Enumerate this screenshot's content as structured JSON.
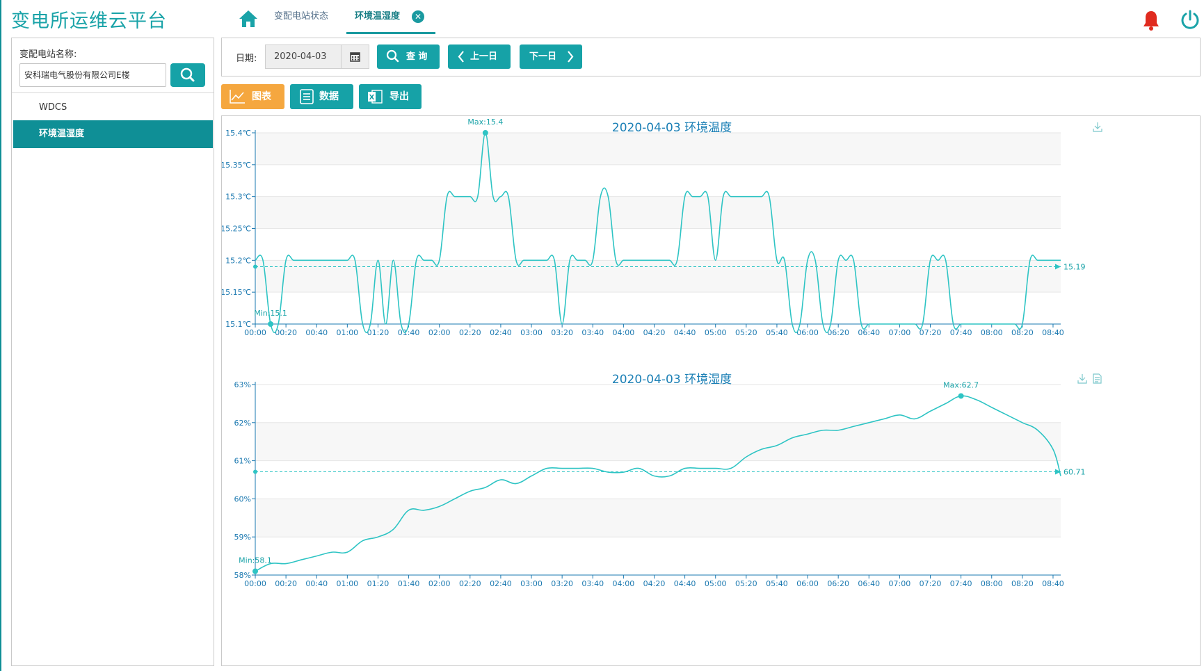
{
  "header": {
    "app_title": "变电所运维云平台",
    "tabs": [
      {
        "label": "变配电站状态"
      },
      {
        "label": "环境温湿度"
      }
    ]
  },
  "sidebar": {
    "search_label": "变配电站名称:",
    "search_value": "安科瑞电气股份有限公司E楼",
    "items": [
      {
        "label": "WDCS"
      },
      {
        "label": "环境温湿度"
      }
    ]
  },
  "toolbar": {
    "date_label": "日期:",
    "date_value": "2020-04-03",
    "query_label": "查 询",
    "prev_label": "上一日",
    "next_label": "下一日"
  },
  "view_buttons": {
    "chart_label": "图表",
    "data_label": "数据",
    "export_label": "导出"
  },
  "colors": {
    "accent": "#16a2a7",
    "line": "#2ec4c4",
    "active_tab": "#f5a73f",
    "bell": "#e02b1f"
  },
  "chart_data": [
    {
      "type": "line",
      "title": "2020-04-03  环境温度",
      "x": [
        "00:00",
        "00:05",
        "00:10",
        "00:15",
        "00:20",
        "00:25",
        "00:30",
        "00:35",
        "00:40",
        "00:45",
        "00:50",
        "00:55",
        "01:00",
        "01:05",
        "01:10",
        "01:15",
        "01:20",
        "01:25",
        "01:30",
        "01:35",
        "01:40",
        "01:45",
        "01:50",
        "01:55",
        "02:00",
        "02:05",
        "02:10",
        "02:15",
        "02:20",
        "02:25",
        "02:30",
        "02:35",
        "02:40",
        "02:45",
        "02:50",
        "02:55",
        "03:00",
        "03:05",
        "03:10",
        "03:15",
        "03:20",
        "03:25",
        "03:30",
        "03:35",
        "03:40",
        "03:45",
        "03:50",
        "03:55",
        "04:00",
        "04:05",
        "04:10",
        "04:15",
        "04:20",
        "04:25",
        "04:30",
        "04:35",
        "04:40",
        "04:45",
        "04:50",
        "04:55",
        "05:00",
        "05:05",
        "05:10",
        "05:15",
        "05:20",
        "05:25",
        "05:30",
        "05:35",
        "05:40",
        "05:45",
        "05:50",
        "05:55",
        "06:00",
        "06:05",
        "06:10",
        "06:15",
        "06:20",
        "06:25",
        "06:30",
        "06:35",
        "06:40",
        "06:45",
        "06:50",
        "06:55",
        "07:00",
        "07:05",
        "07:10",
        "07:15",
        "07:20",
        "07:25",
        "07:30",
        "07:35",
        "07:40",
        "07:45",
        "07:50",
        "07:55",
        "08:00",
        "08:05",
        "08:10",
        "08:15",
        "08:20",
        "08:25",
        "08:30",
        "08:35",
        "08:40",
        "08:45"
      ],
      "series": [
        {
          "values": [
            15.2,
            15.2,
            15.1,
            15.1,
            15.2,
            15.2,
            15.2,
            15.2,
            15.2,
            15.2,
            15.2,
            15.2,
            15.2,
            15.2,
            15.1,
            15.1,
            15.2,
            15.1,
            15.2,
            15.1,
            15.1,
            15.2,
            15.2,
            15.2,
            15.2,
            15.3,
            15.3,
            15.3,
            15.3,
            15.3,
            15.4,
            15.3,
            15.3,
            15.3,
            15.2,
            15.2,
            15.2,
            15.2,
            15.2,
            15.2,
            15.1,
            15.2,
            15.2,
            15.2,
            15.2,
            15.3,
            15.3,
            15.2,
            15.2,
            15.2,
            15.2,
            15.2,
            15.2,
            15.2,
            15.2,
            15.2,
            15.3,
            15.3,
            15.3,
            15.3,
            15.2,
            15.3,
            15.3,
            15.3,
            15.3,
            15.3,
            15.3,
            15.3,
            15.2,
            15.2,
            15.1,
            15.1,
            15.2,
            15.2,
            15.1,
            15.1,
            15.2,
            15.2,
            15.2,
            15.1,
            15.1,
            15.1,
            15.1,
            15.1,
            15.1,
            15.1,
            15.1,
            15.1,
            15.2,
            15.2,
            15.2,
            15.1,
            15.1,
            15.1,
            15.1,
            15.1,
            15.1,
            15.1,
            15.1,
            15.1,
            15.1,
            15.2,
            15.2,
            15.2,
            15.2,
            15.2,
            15.2,
            15.2
          ]
        }
      ],
      "y_ticks": [
        "15.1℃",
        "15.15℃",
        "15.2℃",
        "15.25℃",
        "15.3℃",
        "15.35℃",
        "15.4℃"
      ],
      "x_ticks": [
        "00:00",
        "00:20",
        "00:40",
        "01:00",
        "01:20",
        "01:40",
        "02:00",
        "02:20",
        "02:40",
        "03:00",
        "03:20",
        "03:40",
        "04:00",
        "04:20",
        "04:40",
        "05:00",
        "05:20",
        "05:40",
        "06:00",
        "06:20",
        "06:40",
        "07:00",
        "07:20",
        "07:40",
        "08:00",
        "08:20",
        "08:40"
      ],
      "ylim": [
        15.1,
        15.4
      ],
      "max_label": "Max:15.4",
      "min_label": "Min:15.1",
      "avg": 15.19,
      "avg_label": "15.19",
      "grid": true
    },
    {
      "type": "line",
      "title": "2020-04-03  环境湿度",
      "x": [
        "00:00",
        "00:10",
        "00:20",
        "00:30",
        "00:40",
        "00:50",
        "01:00",
        "01:10",
        "01:20",
        "01:30",
        "01:40",
        "01:50",
        "02:00",
        "02:10",
        "02:20",
        "02:30",
        "02:40",
        "02:50",
        "03:00",
        "03:10",
        "03:20",
        "03:30",
        "03:40",
        "03:50",
        "04:00",
        "04:10",
        "04:20",
        "04:30",
        "04:40",
        "04:50",
        "05:00",
        "05:10",
        "05:20",
        "05:30",
        "05:40",
        "05:50",
        "06:00",
        "06:10",
        "06:20",
        "06:30",
        "06:40",
        "06:50",
        "07:00",
        "07:10",
        "07:20",
        "07:30",
        "07:40",
        "07:50",
        "08:00",
        "08:10",
        "08:20",
        "08:30",
        "08:40",
        "08:45"
      ],
      "series": [
        {
          "values": [
            58.1,
            58.3,
            58.3,
            58.4,
            58.5,
            58.6,
            58.6,
            58.9,
            59.0,
            59.2,
            59.7,
            59.7,
            59.8,
            60.0,
            60.2,
            60.3,
            60.5,
            60.4,
            60.6,
            60.8,
            60.8,
            60.8,
            60.8,
            60.7,
            60.7,
            60.8,
            60.6,
            60.6,
            60.8,
            60.8,
            60.8,
            60.8,
            61.1,
            61.3,
            61.4,
            61.6,
            61.7,
            61.8,
            61.8,
            61.9,
            62.0,
            62.1,
            62.2,
            62.1,
            62.3,
            62.5,
            62.7,
            62.6,
            62.4,
            62.2,
            62.0,
            61.8,
            61.3,
            60.6
          ]
        }
      ],
      "y_ticks": [
        "58%",
        "59%",
        "60%",
        "61%",
        "62%",
        "63%"
      ],
      "x_ticks": [
        "00:00",
        "00:20",
        "00:40",
        "01:00",
        "01:20",
        "01:40",
        "02:00",
        "02:20",
        "02:40",
        "03:00",
        "03:20",
        "03:40",
        "04:00",
        "04:20",
        "04:40",
        "05:00",
        "05:20",
        "05:40",
        "06:00",
        "06:20",
        "06:40",
        "07:00",
        "07:20",
        "07:40",
        "08:00",
        "08:20",
        "08:40"
      ],
      "ylim": [
        58,
        63
      ],
      "max_label": "Max:62.7",
      "min_label": "Min:58.1",
      "avg": 60.71,
      "avg_label": "60.71",
      "grid": true
    }
  ]
}
